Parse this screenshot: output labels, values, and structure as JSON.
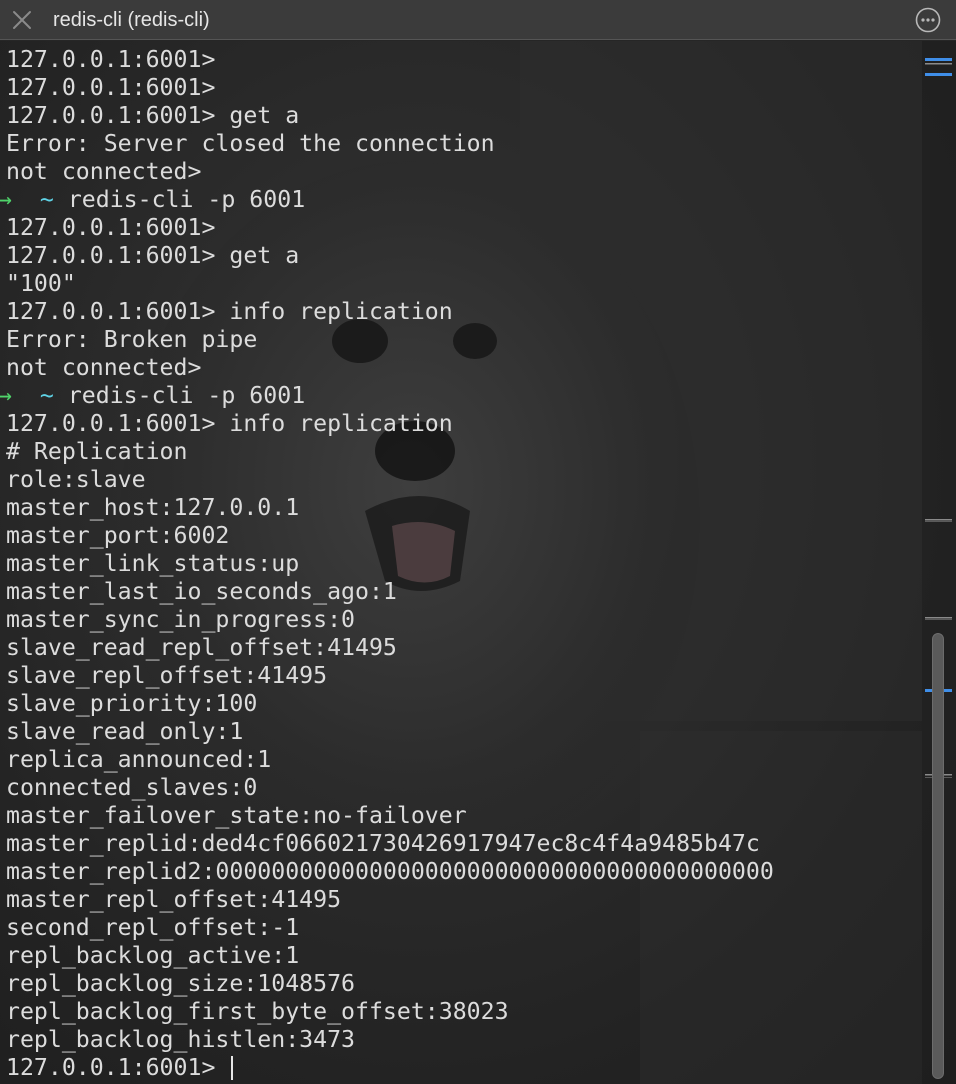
{
  "window": {
    "title": "redis-cli (redis-cli)",
    "close_icon": "close-icon",
    "more_icon": "more-options-icon"
  },
  "terminal": {
    "lines": [
      {
        "kind": "text",
        "text": "127.0.0.1:6001>"
      },
      {
        "kind": "text",
        "text": "127.0.0.1:6001>"
      },
      {
        "kind": "text",
        "text": "127.0.0.1:6001> get a"
      },
      {
        "kind": "text",
        "text": "Error: Server closed the connection"
      },
      {
        "kind": "text",
        "text": "not connected>"
      },
      {
        "kind": "shell",
        "arrow": "→",
        "tilde": "~",
        "text": "redis-cli -p 6001"
      },
      {
        "kind": "text",
        "text": "127.0.0.1:6001>"
      },
      {
        "kind": "text",
        "text": "127.0.0.1:6001> get a"
      },
      {
        "kind": "text",
        "text": "\"100\""
      },
      {
        "kind": "text",
        "text": "127.0.0.1:6001> info replication"
      },
      {
        "kind": "text",
        "text": "Error: Broken pipe"
      },
      {
        "kind": "text",
        "text": "not connected>"
      },
      {
        "kind": "shell",
        "arrow": "→",
        "tilde": "~",
        "text": "redis-cli -p 6001"
      },
      {
        "kind": "text",
        "text": "127.0.0.1:6001> info replication"
      },
      {
        "kind": "text",
        "text": "# Replication"
      },
      {
        "kind": "text",
        "text": "role:slave"
      },
      {
        "kind": "text",
        "text": "master_host:127.0.0.1"
      },
      {
        "kind": "text",
        "text": "master_port:6002"
      },
      {
        "kind": "text",
        "text": "master_link_status:up"
      },
      {
        "kind": "text",
        "text": "master_last_io_seconds_ago:1"
      },
      {
        "kind": "text",
        "text": "master_sync_in_progress:0"
      },
      {
        "kind": "text",
        "text": "slave_read_repl_offset:41495"
      },
      {
        "kind": "text",
        "text": "slave_repl_offset:41495"
      },
      {
        "kind": "text",
        "text": "slave_priority:100"
      },
      {
        "kind": "text",
        "text": "slave_read_only:1"
      },
      {
        "kind": "text",
        "text": "replica_announced:1"
      },
      {
        "kind": "text",
        "text": "connected_slaves:0"
      },
      {
        "kind": "text",
        "text": "master_failover_state:no-failover"
      },
      {
        "kind": "text",
        "text": "master_replid:ded4cf066021730426917947ec8c4f4a9485b47c"
      },
      {
        "kind": "text",
        "text": "master_replid2:0000000000000000000000000000000000000000"
      },
      {
        "kind": "text",
        "text": "master_repl_offset:41495"
      },
      {
        "kind": "text",
        "text": "second_repl_offset:-1"
      },
      {
        "kind": "text",
        "text": "repl_backlog_active:1"
      },
      {
        "kind": "text",
        "text": "repl_backlog_size:1048576"
      },
      {
        "kind": "text",
        "text": "repl_backlog_first_byte_offset:38023"
      },
      {
        "kind": "text",
        "text": "repl_backlog_histlen:3473"
      },
      {
        "kind": "prompt",
        "text": "127.0.0.1:6001> "
      }
    ]
  },
  "colors": {
    "text": "#dcdcdc",
    "arrow": "#4fd36a",
    "tilde": "#5fd3e6",
    "minimap_marker": "#3f8ee8"
  }
}
